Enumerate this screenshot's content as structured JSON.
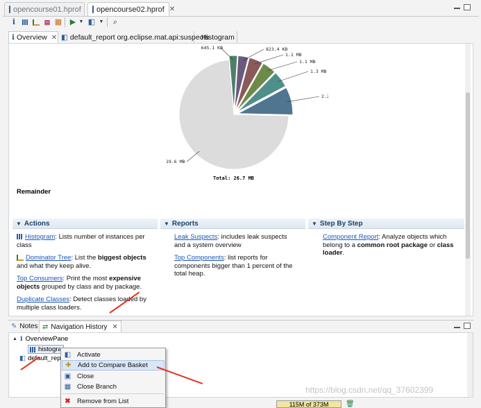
{
  "editor_tabs": [
    {
      "label": "opencourse01.hprof",
      "active": false
    },
    {
      "label": "opencourse02.hprof",
      "active": true
    }
  ],
  "sub_tabs": [
    {
      "label": "Overview",
      "icon": "info-icon"
    },
    {
      "label": "default_report  org.eclipse.mat.api:suspects",
      "icon": "report-icon"
    },
    {
      "label": "Histogram",
      "icon": "histogram-icon"
    }
  ],
  "toolbar_icons": [
    "info-icon",
    "histogram-icon",
    "dominator-tree-icon",
    "oql-icon",
    "thread-icon",
    "run-report-icon",
    "dropdown-icon",
    "query-browser-icon",
    "dropdown-icon",
    "search-icon"
  ],
  "pie": {
    "labels": [
      "645.1 KB",
      "823.4 KB",
      "1.1 MB",
      "1.1 MB",
      "1.3 MB",
      "2.2 MB",
      "19.6 MB"
    ],
    "total": "Total: 26.7 MB",
    "caption": "Remainder"
  },
  "chart_data": {
    "type": "pie",
    "title": "",
    "slices": [
      {
        "label": "645.1 KB",
        "value": 0.645,
        "color": "#4f7f6a"
      },
      {
        "label": "823.4 KB",
        "value": 0.823,
        "color": "#6a5a80"
      },
      {
        "label": "1.1 MB",
        "value": 1.1,
        "color": "#8a5a5a"
      },
      {
        "label": "1.1 MB",
        "value": 1.1,
        "color": "#6e8a48"
      },
      {
        "label": "1.3 MB",
        "value": 1.3,
        "color": "#4f8f8a"
      },
      {
        "label": "2.2 MB",
        "value": 2.2,
        "color": "#4f7590"
      },
      {
        "label": "19.6 MB",
        "value": 19.6,
        "color": "#dcdcdc"
      }
    ],
    "total": 26.7,
    "unit": "MB"
  },
  "actions": {
    "title": "Actions",
    "items": [
      {
        "link": "Histogram",
        "text": ": Lists number of instances per class"
      },
      {
        "link": "Dominator Tree",
        "text_pre": ": List the ",
        "bold": "biggest objects",
        "text_post": " and what they keep alive."
      },
      {
        "link": "Top Consumers",
        "text_pre": ": Print the most ",
        "bold": "expensive objects",
        "text_post": " grouped by class and by package."
      },
      {
        "link": "Duplicate Classes",
        "text": ": Detect classes loaded by multiple class loaders."
      }
    ]
  },
  "reports": {
    "title": "Reports",
    "items": [
      {
        "link": "Leak Suspects",
        "text": ": includes leak suspects and a system overview"
      },
      {
        "link": "Top Components",
        "text": ": list reports for components bigger than 1 percent of the total heap."
      }
    ]
  },
  "step_by_step": {
    "title": "Step By Step",
    "link": "Component Report",
    "text_pre": ": Analyze objects which belong to a ",
    "bold1": "common root package",
    "text_mid": " or ",
    "bold2": "class loader",
    "text_post": "."
  },
  "bottom_tabs": [
    {
      "label": "Notes"
    },
    {
      "label": "Navigation History"
    }
  ],
  "nav_tree": [
    {
      "label": "OverviewPane",
      "level": 0
    },
    {
      "label": "histogra",
      "level": 1
    },
    {
      "label": "default_rep",
      "level": 0
    }
  ],
  "context_menu": [
    {
      "label": "Activate",
      "icon": "activate-icon"
    },
    {
      "label": "Add to Compare Basket",
      "icon": "compare-basket-icon",
      "highlighted": true
    },
    {
      "label": "Close",
      "icon": "close-page-icon"
    },
    {
      "label": "Close Branch",
      "icon": "close-branch-icon"
    },
    {
      "label": "Remove from List",
      "icon": "remove-icon"
    }
  ],
  "status": {
    "heap": "115M of 373M"
  },
  "watermark": "https://blog.csdn.net/qq_37602399",
  "colors": {
    "accent": "#17406b",
    "link": "#1a55b5",
    "arrow": "#e53324"
  }
}
